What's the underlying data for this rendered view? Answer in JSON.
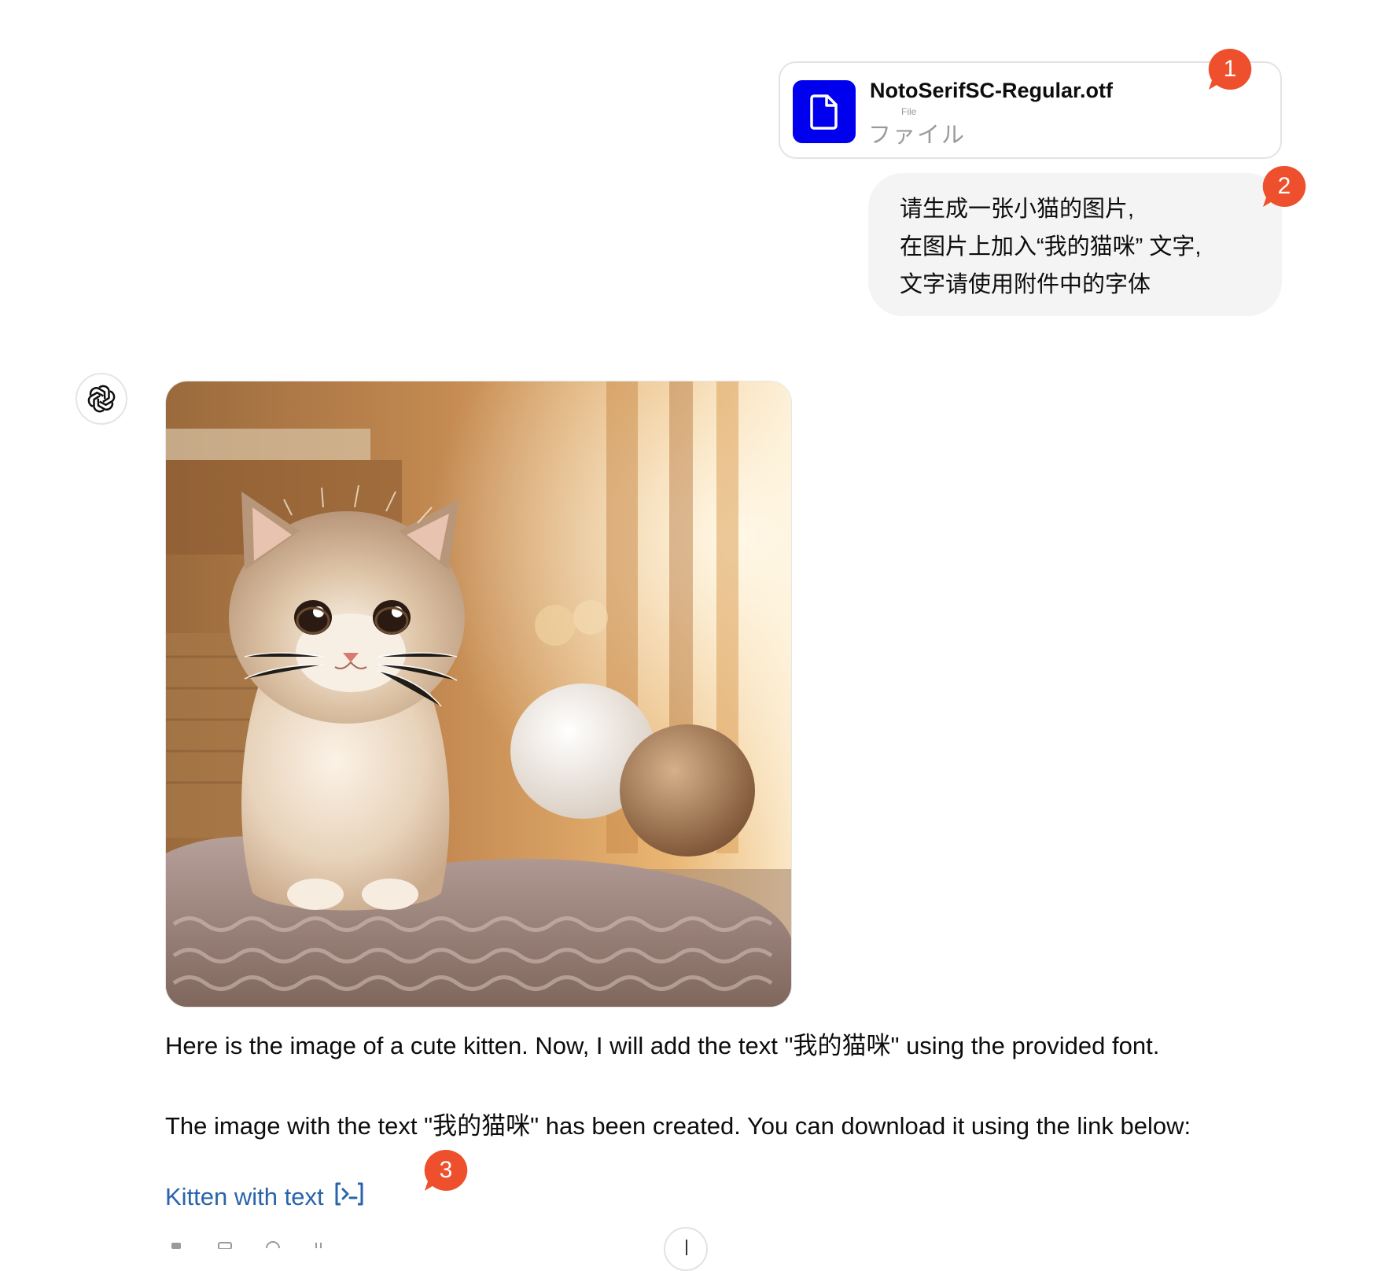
{
  "attachment": {
    "file_name": "NotoSerifSC-Regular.otf",
    "file_type_small": "File",
    "file_type": "ファイル",
    "icon": "document-icon",
    "icon_tile_color": "#0000ee"
  },
  "user_message": {
    "lines": [
      "请生成一张小猫的图片,",
      "在图片上加入“我的猫咪” 文字,",
      "文字请使用附件中的字体"
    ]
  },
  "markers": [
    {
      "number": "1"
    },
    {
      "number": "2"
    },
    {
      "number": "3"
    }
  ],
  "marker_color": "#ee4f2c",
  "assistant": {
    "avatar_icon": "openai-logo-icon",
    "generated_image": "kitten-on-knitted-blanket-image",
    "reply_1": "Here is the image of a cute kitten. Now, I will add the text \"我的猫咪\" using the provided font.",
    "reply_2": "The image with the text \"我的猫咪\" has been created. You can download it using the link below:",
    "link_label": "Kitten with text",
    "link_icon": "code-interpreter-icon",
    "link_color": "#2964aa"
  },
  "controls": {
    "scroll_down_icon": "arrow-down-icon"
  }
}
